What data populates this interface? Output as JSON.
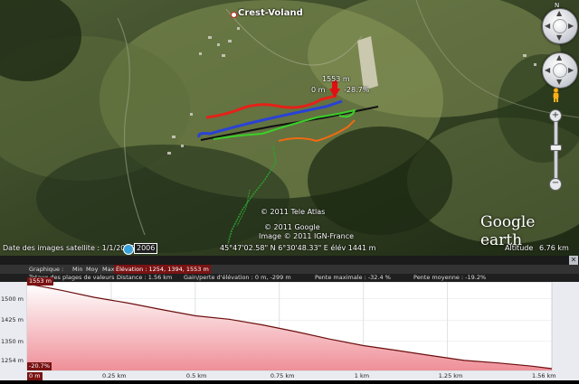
{
  "map": {
    "place_label": "Crest-Voland",
    "profile_marker": {
      "elevation": "1553 m",
      "distance": "0 m",
      "grade": "-28.7%"
    },
    "copyright": [
      "© 2011 Tele Atlas",
      "© 2011 Google",
      "Image © 2011 IGN-France"
    ],
    "brand": "Google earth",
    "imagery_date_label": "Date des images satellite : 1/1/2006",
    "imagery_year": "2006",
    "cursor_readout": "45°47'02.58\" N   6°30'48.33\" E  élév  1441 m",
    "altitude_label": "Altitude",
    "altitude_value": "6.76 km",
    "track_colors": [
      "#e52118",
      "#2a42d6",
      "#111111",
      "#3ccf2a",
      "#f06a12",
      "#2f9e2f"
    ]
  },
  "profile": {
    "row1": {
      "graph_label": "Graphique :",
      "min": "Min",
      "avg": "Moy",
      "max": "Max",
      "elevation_label": "Élévation : 1254, 1394, 1553 m"
    },
    "row2": {
      "totals_label": "Totaux des plages de valeurs :",
      "distance": "Distance : 1.56 km",
      "gain_loss": "Gain/perte d'élévation : 0 m, -299 m",
      "max_slope": "Pente maximale : -32.4 %",
      "avg_slope": "Pente moyenne : -19.2%"
    },
    "start_elevation_tag": "1553 m",
    "end_grade_tag": "-20.7%",
    "start_distance_tag": "0 m"
  },
  "chart_data": {
    "type": "area",
    "xlabel": "",
    "ylabel": "",
    "x_ticks": [
      "0 m",
      "0.25 km",
      "0.5 km",
      "0.75 km",
      "1 km",
      "1.25 km",
      "1.56 km"
    ],
    "y_ticks": [
      "1553 m",
      "1500 m",
      "1425 m",
      "1350 m",
      "1254 m"
    ],
    "xlim": [
      0,
      1.56
    ],
    "ylim": [
      1254,
      1553
    ],
    "x": [
      0,
      0.1,
      0.2,
      0.3,
      0.4,
      0.5,
      0.6,
      0.7,
      0.8,
      0.9,
      1.0,
      1.1,
      1.2,
      1.3,
      1.4,
      1.5,
      1.56
    ],
    "y": [
      1553,
      1530,
      1505,
      1485,
      1462,
      1440,
      1428,
      1408,
      1384,
      1358,
      1335,
      1318,
      1300,
      1283,
      1274,
      1263,
      1254
    ],
    "line_color": "#6b0e0e",
    "fill_top": "#ffffff",
    "fill_bottom": "#ef8f98"
  }
}
